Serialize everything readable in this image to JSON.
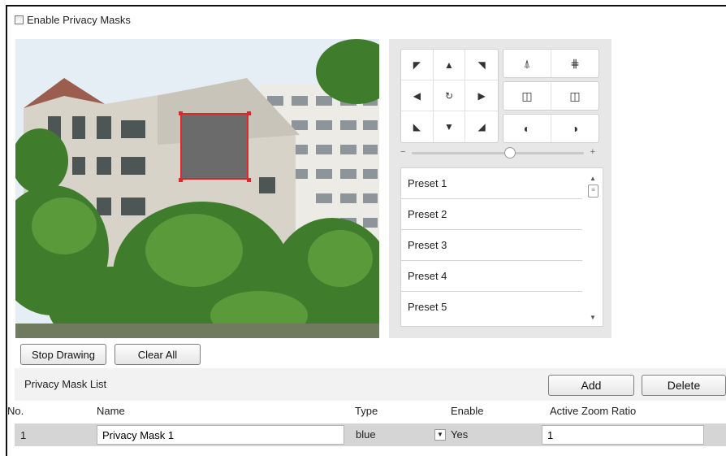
{
  "privacy": {
    "enable_label": "Enable Privacy Masks",
    "enabled": false
  },
  "ptz": {
    "arrows": [
      "◤",
      "▲",
      "◥",
      "◀",
      "↻",
      "▶",
      "◣",
      "▼",
      "◢"
    ],
    "zoom_icons": [
      "⍋",
      "⋕"
    ],
    "focus_icons": [
      "◫",
      "◫"
    ],
    "iris_icons": [
      "◐",
      "◑"
    ],
    "slider_minus": "−",
    "slider_plus": "+",
    "presets": [
      "Preset 1",
      "Preset 2",
      "Preset 3",
      "Preset 4",
      "Preset 5"
    ]
  },
  "drawing": {
    "stop_label": "Stop Drawing",
    "clear_label": "Clear All"
  },
  "list": {
    "title": "Privacy Mask List",
    "add_label": "Add",
    "delete_label": "Delete",
    "columns": {
      "no": "No.",
      "name": "Name",
      "type": "Type",
      "enable": "Enable",
      "zoom": "Active Zoom Ratio"
    },
    "rows": [
      {
        "no": "1",
        "name": "Privacy Mask 1",
        "type": "blue",
        "enable": "Yes",
        "zoom": "1"
      }
    ]
  },
  "colors": {
    "mask_fill": "#6b6b6b",
    "mask_border": "#e0262b",
    "row_bg": "#d5d5d5"
  }
}
